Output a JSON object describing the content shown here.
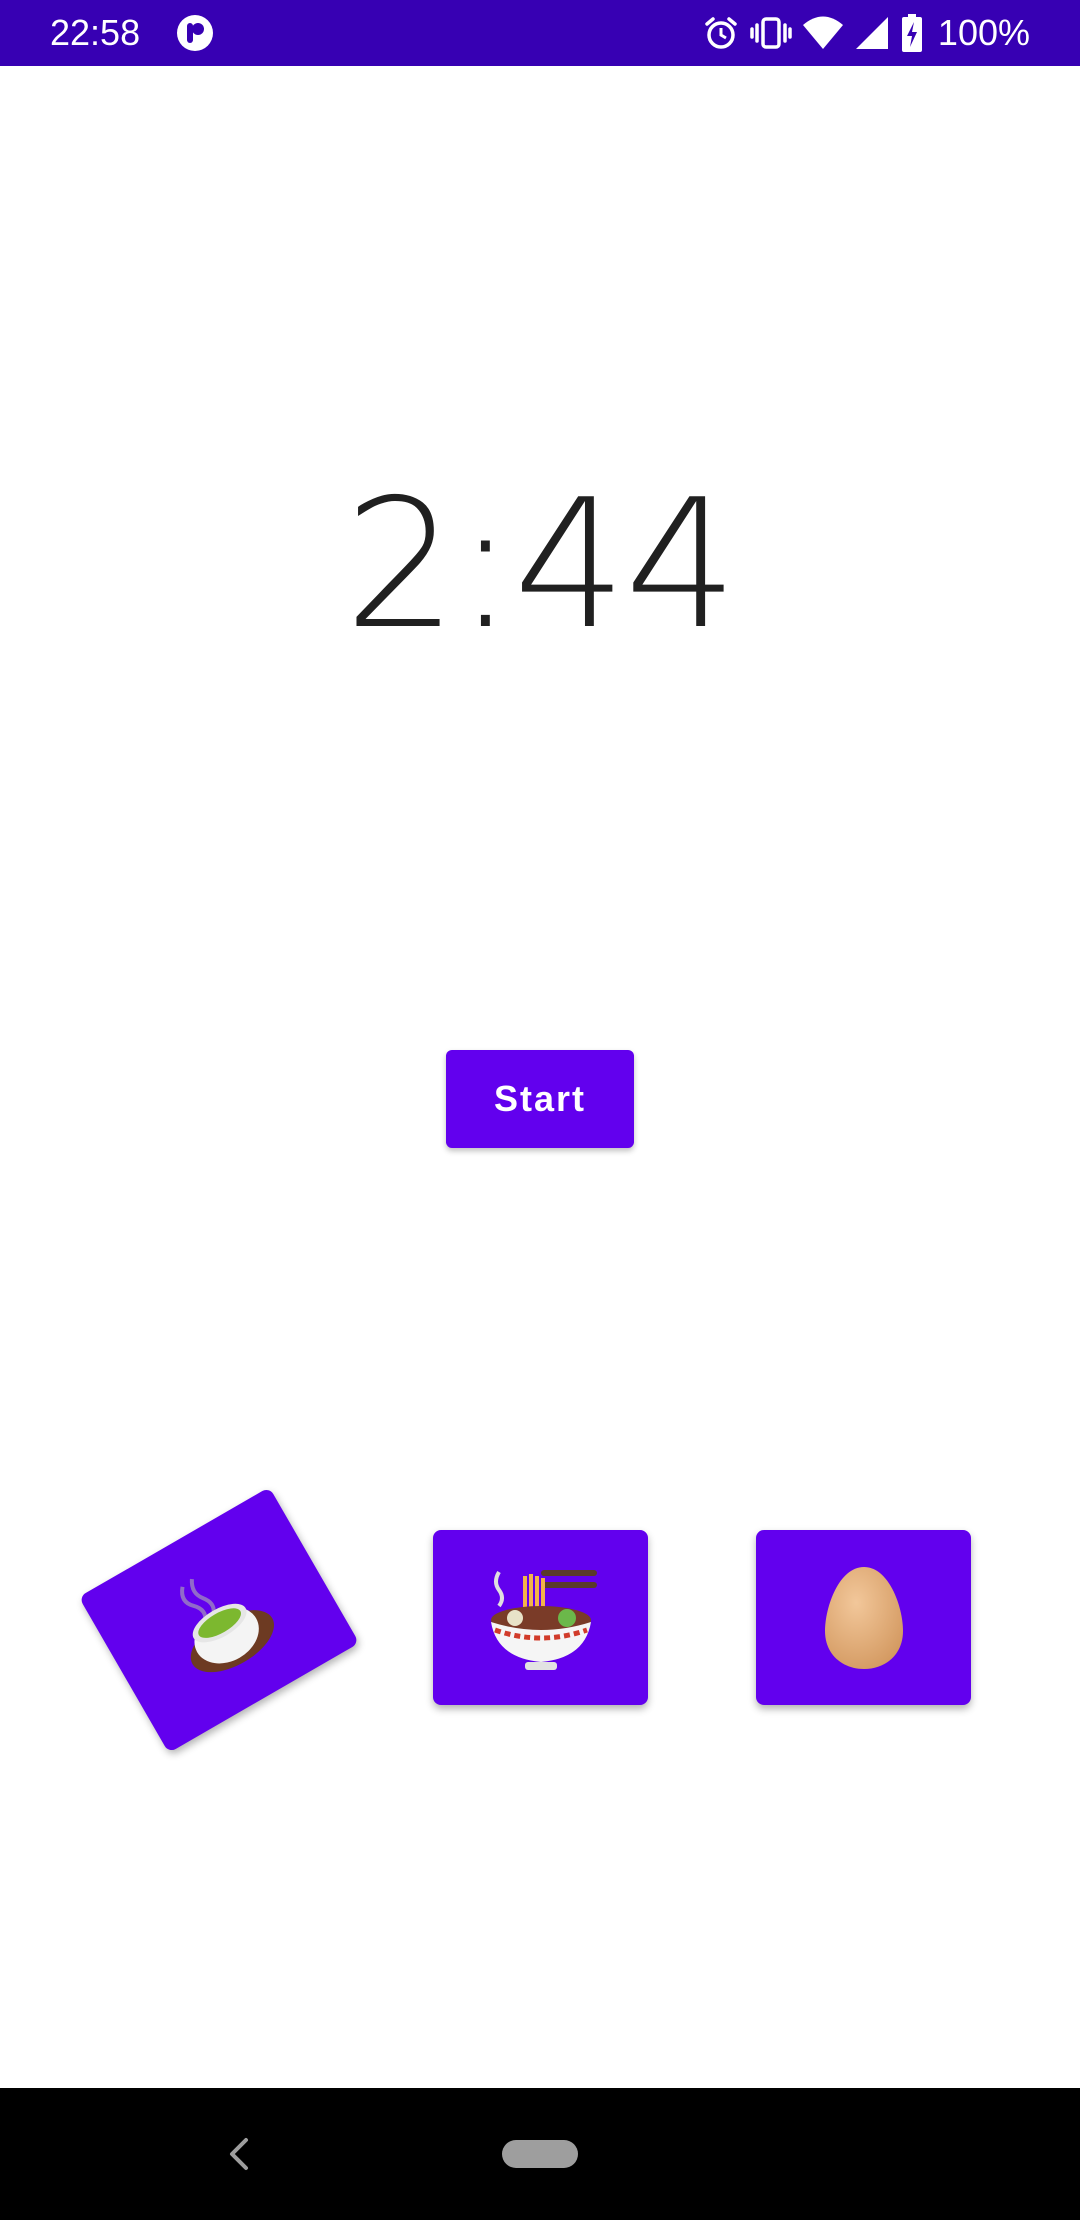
{
  "status_bar": {
    "time": "22:58",
    "battery_percent": "100%",
    "background_color": "#3700b3",
    "icons": [
      "app-notification-icon",
      "alarm-icon",
      "vibrate-icon",
      "wifi-icon",
      "signal-icon",
      "battery-charging-icon"
    ]
  },
  "timer": {
    "display": "2:44"
  },
  "start_button": {
    "label": "Start",
    "color": "#6200ee"
  },
  "food_options": [
    {
      "name": "tea",
      "icon": "green-tea-icon",
      "selected": true
    },
    {
      "name": "noodles",
      "icon": "ramen-bowl-icon",
      "selected": false
    },
    {
      "name": "egg",
      "icon": "egg-icon",
      "selected": false
    }
  ],
  "nav_bar": {
    "icons": [
      "back-icon",
      "home-pill-icon"
    ]
  }
}
